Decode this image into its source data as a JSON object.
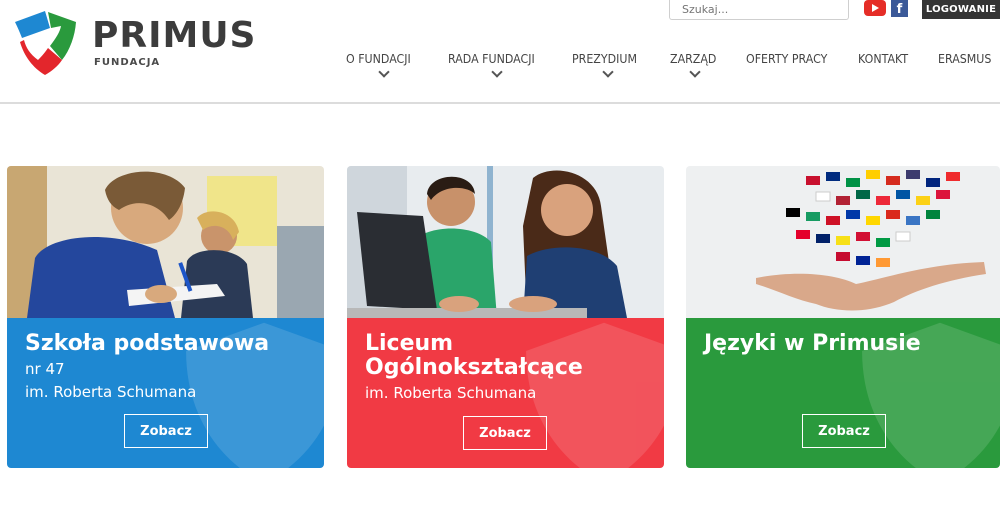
{
  "brand": {
    "name": "PRIMUS",
    "subtitle": "FUNDACJA",
    "colors": {
      "red": "#e3262c",
      "green": "#2a9a3d",
      "blue": "#1e88d2"
    }
  },
  "topbar": {
    "search_placeholder": "Szukaj...",
    "social": [
      "youtube-icon",
      "facebook-icon"
    ],
    "facebook_glyph": "f",
    "login_label": "LOGOWANIE"
  },
  "nav": {
    "items": [
      {
        "label": "O FUNDACJI",
        "has_dropdown": true
      },
      {
        "label": "RADA FUNDACJI",
        "has_dropdown": true
      },
      {
        "label": "PREZYDIUM",
        "has_dropdown": true
      },
      {
        "label": "ZARZĄD",
        "has_dropdown": true
      },
      {
        "label": "OFERTY PRACY",
        "has_dropdown": false
      },
      {
        "label": "KONTAKT",
        "has_dropdown": false
      },
      {
        "label": "ERASMUS",
        "has_dropdown": false
      }
    ]
  },
  "cards": [
    {
      "title": "Szkoła podstawowa",
      "line2": "nr 47",
      "line3": "im. Roberta Schumana",
      "button": "Zobacz",
      "color": "#1e88d2"
    },
    {
      "title": "Liceum",
      "line2": "Ogólnokształcące",
      "line3": "im. Roberta Schumana",
      "button": "Zobacz",
      "color": "#f13a44"
    },
    {
      "title": "Języki w Primusie",
      "button": "Zobacz",
      "color": "#2a9a3d"
    }
  ]
}
